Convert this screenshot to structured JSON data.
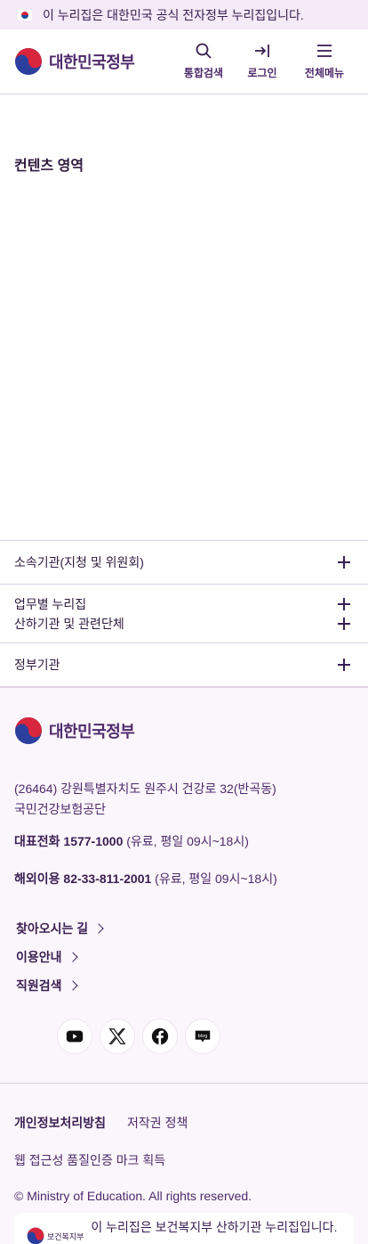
{
  "banner": {
    "text": "이 누리집은 대한민국 공식 전자정부 누리집입니다."
  },
  "header": {
    "logo_text": "대한민국정부",
    "actions": [
      {
        "label": "통합검색",
        "icon": "search-icon"
      },
      {
        "label": "로그인",
        "icon": "login-icon"
      },
      {
        "label": "전체메뉴",
        "icon": "menu-icon"
      }
    ]
  },
  "content": {
    "title": "컨텐츠 영역"
  },
  "accordion": {
    "items": [
      {
        "label": "소속기관(지청 및 위원회)"
      },
      {
        "label": "업무별 누리집"
      },
      {
        "label": "산하기관 및 관련단체"
      },
      {
        "label": "정부기관"
      }
    ]
  },
  "footer": {
    "logo_text": "대한민국정부",
    "address": "(26464) 강원특별자치도 원주시 건강로 32(반곡동)",
    "org": "국민건강보험공단",
    "tel_label": "대표전화 1577-1000",
    "tel_hours": " (유료, 평일 09시~18시)",
    "intl_label": "해외이용 82-33-811-2001",
    "intl_hours": " (유료, 평일 09시~18시)",
    "links": [
      {
        "label": "찾아오시는 길"
      },
      {
        "label": "이용안내"
      },
      {
        "label": "직원검색"
      }
    ],
    "socials": [
      {
        "name": "youtube-icon"
      },
      {
        "name": "x-icon"
      },
      {
        "name": "facebook-icon"
      },
      {
        "name": "blog-icon",
        "label": "blog"
      }
    ],
    "privacy": "개인정보처리방침",
    "copyright_policy": "저작권 정책",
    "accessibility": "웹 접근성 품질인증 마크 획득",
    "copyright": "© Ministry of Education. All rights reserved."
  },
  "badge": {
    "logo_text": "보건복지부",
    "text": "이 누리집은 보건복지부 산하기관 누리집입니다."
  },
  "colors": {
    "primary": "#4e2a6b",
    "banner_bg": "#f5eaf7",
    "footer_bg": "#fbf6fb"
  }
}
